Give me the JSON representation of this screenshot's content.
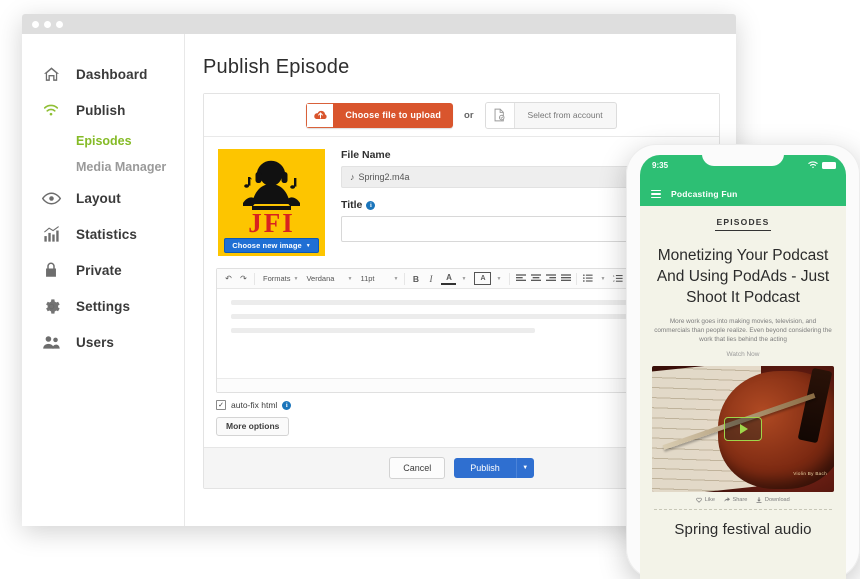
{
  "window": {
    "dots": 3
  },
  "sidebar": {
    "items": [
      {
        "label": "Dashboard",
        "icon": "home-icon"
      },
      {
        "label": "Publish",
        "icon": "wifi-broadcast-icon"
      },
      {
        "label": "Layout",
        "icon": "eye-icon"
      },
      {
        "label": "Statistics",
        "icon": "bar-chart-icon"
      },
      {
        "label": "Private",
        "icon": "lock-icon"
      },
      {
        "label": "Settings",
        "icon": "gear-icon"
      },
      {
        "label": "Users",
        "icon": "users-icon"
      }
    ],
    "sub_items": [
      {
        "label": "Episodes",
        "active": true
      },
      {
        "label": "Media Manager",
        "active": false
      }
    ]
  },
  "main": {
    "page_title": "Publish Episode",
    "upload": {
      "choose_file_label": "Choose file to upload",
      "or_label": "or",
      "select_account_label": "Select from account",
      "upload_icon": "cloud-upload-icon",
      "account_icon": "document-check-icon"
    },
    "album_art": {
      "text": "JFI",
      "choose_image_label": "Choose new image",
      "background_color": "#fdc500",
      "text_color": "#d8231f"
    },
    "fields": {
      "file_name_label": "File Name",
      "file_name_value": "Spring2.m4a",
      "file_name_icon": "music-note-icon",
      "title_label": "Title",
      "title_value": "",
      "title_placeholder": ""
    },
    "editor": {
      "undo_icon": "undo-icon",
      "redo_icon": "redo-icon",
      "formats_label": "Formats",
      "font_family_label": "Verdana",
      "font_size_label": "11pt",
      "bold_label": "B",
      "italic_label": "I",
      "text_color_label": "A",
      "background_color_label": "A",
      "align_left_icon": "align-left-icon",
      "align_center_icon": "align-center-icon",
      "align_right_icon": "align-right-icon",
      "align_justify_icon": "align-justify-icon",
      "bullet_list_icon": "bullet-list-icon",
      "numbered_list_icon": "numbered-list-icon",
      "table_icon": "table-icon",
      "source_icon": "source-code-icon"
    },
    "options": {
      "autofix_label": "auto-fix html",
      "autofix_checked": true,
      "autofix_check_glyph": "✓",
      "more_options_label": "More options"
    },
    "footer": {
      "cancel_label": "Cancel",
      "publish_label": "Publish",
      "publish_caret_icon": "chevron-down-icon",
      "publish_color": "#2f6fd0"
    }
  },
  "phone": {
    "status": {
      "time": "9:35",
      "wifi_icon": "wifi-icon",
      "battery_icon": "battery-icon"
    },
    "appbar": {
      "menu_icon": "hamburger-menu-icon",
      "title": "Podcasting Fun"
    },
    "content": {
      "section_label": "EPISODES",
      "episode_title": "Monetizing Your Podcast And Using PodAds - Just Shoot It Podcast",
      "description": "More work goes into making movies, television, and commercials than people realize. Even beyond considering the work that lies behind the acting",
      "watch_now_label": "Watch Now",
      "media_credit": "Violin By Bach",
      "play_icon": "play-button-icon",
      "actions": [
        {
          "label": "Like",
          "icon": "heart-icon"
        },
        {
          "label": "Share",
          "icon": "share-icon"
        },
        {
          "label": "Download",
          "icon": "download-icon"
        }
      ],
      "footer_title": "Spring festival audio"
    },
    "accent_color": "#2dbf74"
  }
}
